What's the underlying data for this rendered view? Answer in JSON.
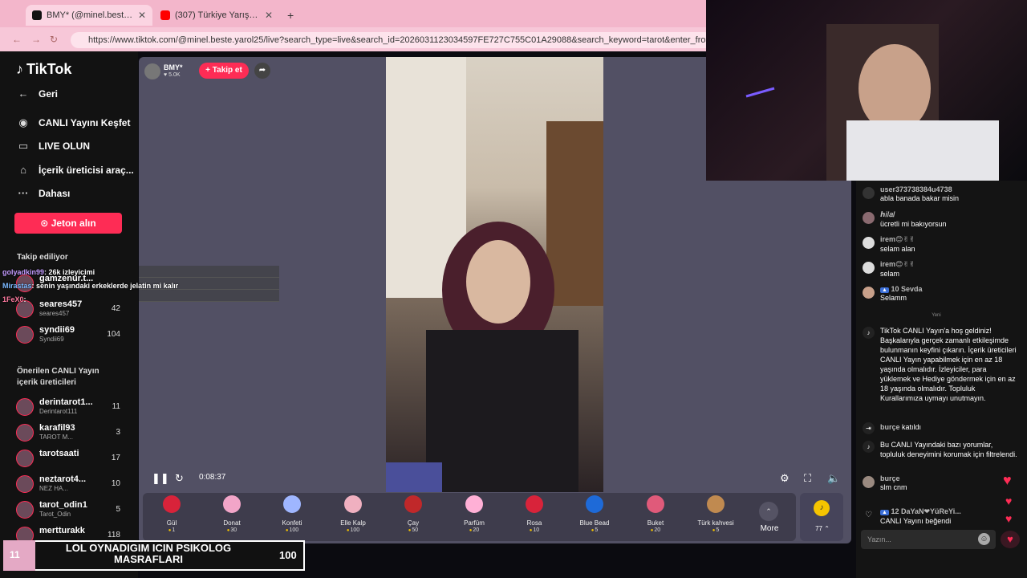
{
  "browser": {
    "tabs": [
      {
        "title": "BMY* (@minel.beste.yarol25)",
        "active": true,
        "fav_color": "#111111"
      },
      {
        "title": "(307) Türkiye Yarışma Programı",
        "active": false,
        "fav_color": "#ff0000"
      }
    ],
    "new_tab": "+",
    "url": "https://www.tiktok.com/@minel.beste.yarol25/live?search_type=live&search_id=2026031123034597FE727C755C01A29088&search_keyword=tarot&enter_from_merge=search_result&ente"
  },
  "sidebar": {
    "logo": "TikTok",
    "nav": [
      {
        "label": "Geri",
        "icon": "back-arrow-icon",
        "glyph": "←"
      },
      {
        "label": "CANLI Yayını Keşfet",
        "icon": "live-explore-icon",
        "glyph": "◉"
      },
      {
        "label": "LIVE OLUN",
        "icon": "camera-icon",
        "glyph": "▭"
      },
      {
        "label": "İçerik üreticisi araç...",
        "icon": "creator-tools-icon",
        "glyph": "⌂"
      },
      {
        "label": "Dahası",
        "icon": "more-dots-icon",
        "glyph": "···"
      }
    ],
    "jeton_button": "Jeton alın",
    "following_title": "Takip ediliyor",
    "following": [
      {
        "name": "gamzenur.t...",
        "sub": "",
        "count": ""
      },
      {
        "name": "seares457",
        "sub": "seares457",
        "count": "42"
      },
      {
        "name": "syndii69",
        "sub": "Syndii69",
        "count": "104"
      }
    ],
    "suggested_title": "Önerilen CANLI Yayın içerik üreticileri",
    "suggested": [
      {
        "name": "derintarot1...",
        "sub": "Derintarot111",
        "count": "11"
      },
      {
        "name": "karafil93",
        "sub": "TAROT M...",
        "count": "3"
      },
      {
        "name": "tarotsaati",
        "sub": "",
        "count": "17"
      },
      {
        "name": "neztarot4...",
        "sub": "NEZ HA...",
        "count": "10"
      },
      {
        "name": "tarot_odin1",
        "sub": "Tarot_Odin",
        "count": "5"
      },
      {
        "name": "mertturakk",
        "sub": "",
        "count": "118"
      }
    ]
  },
  "host": {
    "name": "BMY*",
    "likes": "5.0K",
    "follow": "+ Takip et"
  },
  "player": {
    "time": "0:08:37"
  },
  "gifts": [
    {
      "name": "Gül",
      "price": "1",
      "color": "#d8233a"
    },
    {
      "name": "Donat",
      "price": "30",
      "color": "#f2a5c8"
    },
    {
      "name": "Konfeti",
      "price": "100",
      "color": "#9fb6ff"
    },
    {
      "name": "Elle Kalp",
      "price": "100",
      "color": "#f0b0c0"
    },
    {
      "name": "Çay",
      "price": "50",
      "color": "#c0282a"
    },
    {
      "name": "Parfüm",
      "price": "20",
      "color": "#ffb0d6"
    },
    {
      "name": "Rosa",
      "price": "10",
      "color": "#d8233a"
    },
    {
      "name": "Blue Bead",
      "price": "5",
      "color": "#1e6ad8"
    },
    {
      "name": "Buket",
      "price": "20",
      "color": "#e05a7a"
    },
    {
      "name": "Türk kahvesi",
      "price": "5",
      "color": "#c08a50"
    }
  ],
  "more_label": "More",
  "coins": "77",
  "chat": {
    "messages": [
      {
        "user": "user373738384u4738",
        "text": "abla banada bakar misin"
      },
      {
        "user": "ℎ𝑖𝑙𝑎𝑙",
        "text": "ücretli mi bakıyorsun"
      },
      {
        "user": "irem😊✌✌",
        "text": "selam alan"
      },
      {
        "user": "irem😊✌✌",
        "text": "selam"
      },
      {
        "user": "10 Sevda",
        "text": "Selamm"
      }
    ],
    "new_divider": "Yeni",
    "system_welcome": "TikTok CANLI Yayın'a hoş geldiniz! Başkalarıyla gerçek zamanlı etkileşimde bulunmanın keyfini çıkarın. İçerik üreticileri CANLI Yayın yapabilmek için en az 18 yaşında olmalıdır. İzleyiciler, para yüklemek ve Hediye göndermek için en az 18 yaşında olmalıdır. Topluluk Kurallarımıza uymayı unutmayın.",
    "joined": {
      "user": "burçe",
      "text": "katıldı"
    },
    "filter_note": "Bu CANLI Yayındaki bazı yorumlar, topluluk deneyimini korumak için filtrelendi.",
    "last_msg": {
      "user": "burçe",
      "text": "slm cnm"
    },
    "like_msg": {
      "user": "12 DaYaN❤YüReYi...",
      "text": "CANLI Yayını beğendi"
    },
    "input_placeholder": "Yazın..."
  },
  "overlay_alerts": [
    {
      "user": "golyadkin99",
      "text": ": 26k izleyicimi"
    },
    {
      "user": "Mirastas",
      "text": ": senin yaşındaki erkeklerde jelatin mi kalır"
    },
    {
      "user": "1FeX0",
      "text": ":"
    }
  ],
  "goal": {
    "left": "11",
    "text": "LOL OYNADIGIM ICIN PSIKOLOG MASRAFLARI",
    "value": "100"
  }
}
